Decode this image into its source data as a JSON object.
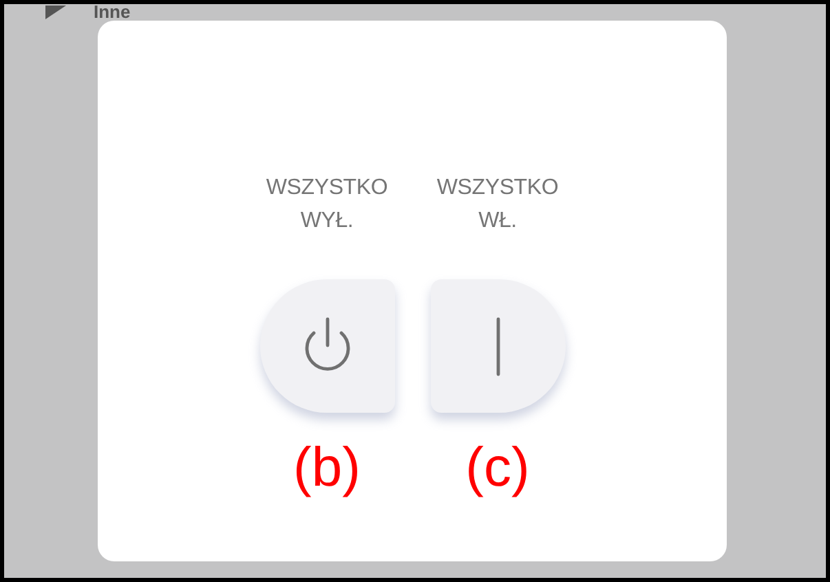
{
  "background": {
    "section_label": "Inne"
  },
  "dialog": {
    "options": [
      {
        "kind": "off",
        "label": "WSZYSTKO WYŁ.",
        "annotation": "(b)"
      },
      {
        "kind": "on",
        "label": "WSZYSTKO WŁ.",
        "annotation": "(c)"
      }
    ]
  }
}
